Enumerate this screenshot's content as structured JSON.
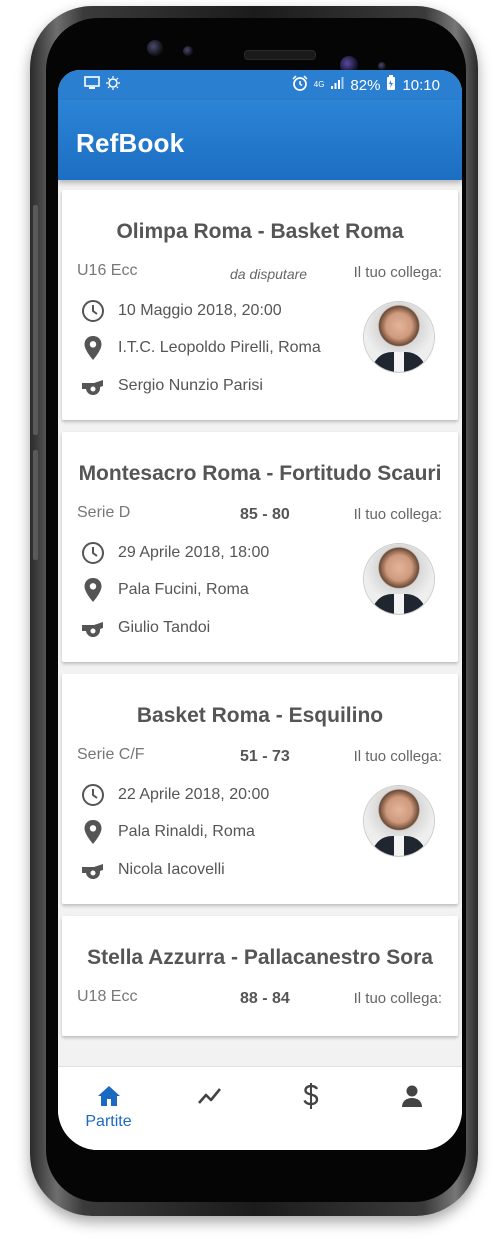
{
  "status_bar": {
    "signal_label": "4G",
    "battery": "82%",
    "time": "10:10"
  },
  "app": {
    "title": "RefBook"
  },
  "colleague_label": "Il tuo collega:",
  "matches": [
    {
      "title": "Olimpa Roma - Basket Roma",
      "category": "U16 Ecc",
      "status": "da disputare",
      "score": "",
      "datetime": "10 Maggio 2018, 20:00",
      "venue": "I.T.C. Leopoldo Pirelli, Roma",
      "referee": "Sergio Nunzio Parisi"
    },
    {
      "title": "Montesacro Roma - Fortitudo Scauri",
      "category": "Serie D",
      "status": "",
      "score": "85 - 80",
      "datetime": "29 Aprile 2018, 18:00",
      "venue": "Pala Fucini, Roma",
      "referee": "Giulio Tandoi"
    },
    {
      "title": "Basket Roma - Esquilino",
      "category": "Serie C/F",
      "status": "",
      "score": "51 - 73",
      "datetime": "22 Aprile 2018, 20:00",
      "venue": "Pala Rinaldi, Roma",
      "referee": "Nicola Iacovelli"
    },
    {
      "title": "Stella Azzurra - Pallacanestro Sora",
      "category": "U18 Ecc",
      "status": "",
      "score": "88 - 84"
    }
  ],
  "bottom_nav": {
    "active_label": "Partite",
    "items": [
      "home-icon",
      "trending-icon",
      "dollar-icon",
      "person-icon"
    ]
  },
  "colors": {
    "primary": "#1c6ec2",
    "status_bar": "#2a7fd0",
    "card_bg": "#ffffff",
    "list_bg": "#f2f2f2"
  }
}
